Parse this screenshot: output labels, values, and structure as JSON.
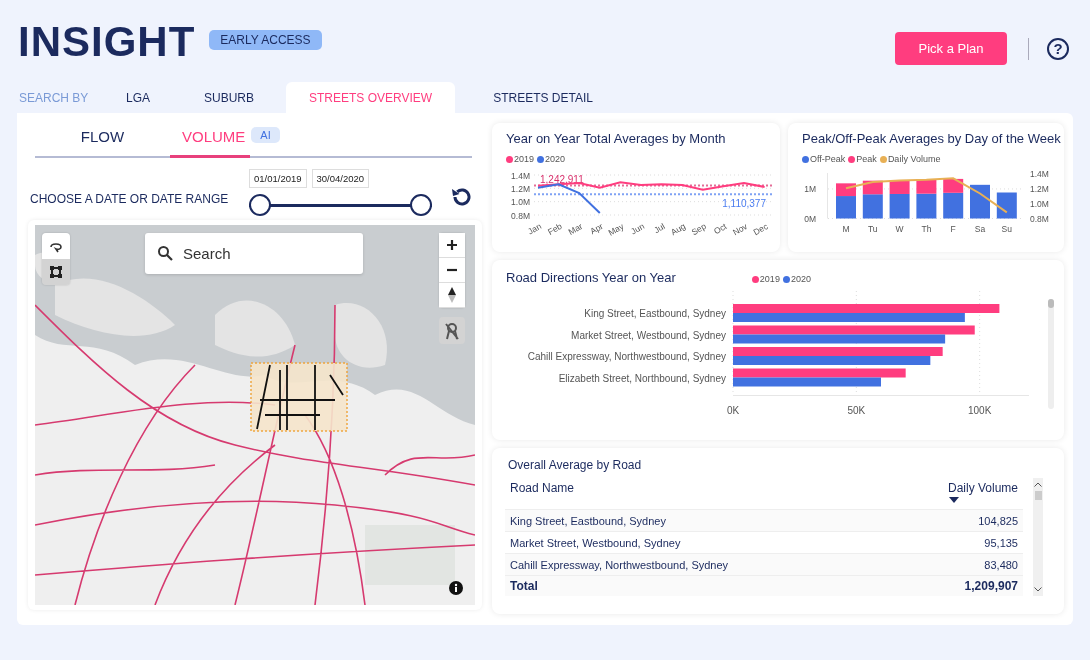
{
  "header": {
    "logo": "INSIGHT",
    "badge": "EARLY ACCESS",
    "plan_button": "Pick a Plan",
    "help_button": "?"
  },
  "nav": {
    "label": "SEARCH BY",
    "tabs": [
      {
        "label": "LGA",
        "selected": false
      },
      {
        "label": "SUBURB",
        "selected": false
      },
      {
        "label": "STREETS OVERVIEW",
        "selected": true
      },
      {
        "label": "STREETS DETAIL",
        "selected": false
      }
    ]
  },
  "view_tabs": [
    {
      "label": "FLOW",
      "selected": false
    },
    {
      "label": "VOLUME",
      "selected": true,
      "badge": "AI"
    }
  ],
  "date_range": {
    "label": "CHOOSE A DATE OR DATE RANGE",
    "start": "01/01/2019",
    "end": "30/04/2020",
    "slider": {
      "level": 1
    }
  },
  "map": {
    "kind": "picture",
    "search": {
      "placeholder": "Search"
    }
  },
  "charts": [
    {
      "chart_data": {
        "type": "line",
        "title": "Year on Year Total Averages by Month",
        "categories": [
          "Jan",
          "Feb",
          "Mar",
          "Apr",
          "May",
          "Jun",
          "Jul",
          "Aug",
          "Sep",
          "Oct",
          "Nov",
          "Dec"
        ],
        "ylim": [
          0.8,
          1.4
        ],
        "yticks": [
          {
            "value": 0.8,
            "label": "0.8M"
          },
          {
            "value": 1.0,
            "label": "1.0M"
          },
          {
            "value": 1.2,
            "label": "1.2M"
          },
          {
            "value": 1.4,
            "label": "1.4M"
          }
        ],
        "series": [
          {
            "name": "2019",
            "color": "#ff3d7f",
            "values": [
              1.24,
              1.26,
              1.28,
              1.21,
              1.29,
              1.25,
              1.26,
              1.25,
              1.18,
              1.23,
              1.28,
              1.22
            ]
          },
          {
            "name": "2020",
            "color": "#4171e0",
            "values": [
              1.21,
              1.26,
              1.13,
              0.83,
              null,
              null,
              null,
              null,
              null,
              null,
              null,
              null
            ]
          }
        ],
        "ref_lines": [
          {
            "axis": "y",
            "value": 1.242911,
            "label": "1,242,911",
            "color": "#d9306c"
          },
          {
            "axis": "y",
            "value": 1.110377,
            "label": "1,110,377",
            "color": "#4a7cf0"
          }
        ]
      }
    },
    {
      "chart_data": {
        "type": "bar",
        "stacked": true,
        "title": "Peak/Off-Peak Averages by Day of the Week",
        "categories": [
          "M",
          "Tu",
          "W",
          "Th",
          "F",
          "Sa",
          "Su"
        ],
        "ylim": [
          0,
          1.54
        ],
        "yticks": [
          {
            "value": 0,
            "label": "0M"
          },
          {
            "value": 1,
            "label": "1M"
          }
        ],
        "y2lim": [
          0.8,
          1.4
        ],
        "y2ticks": [
          {
            "value": 0.8,
            "label": "0.8M"
          },
          {
            "value": 1.0,
            "label": "1.0M"
          },
          {
            "value": 1.2,
            "label": "1.2M"
          },
          {
            "value": 1.4,
            "label": "1.4M"
          }
        ],
        "series": [
          {
            "name": "Off-Peak",
            "color": "#4171e0",
            "type": "bar",
            "values": [
              0.76,
              0.82,
              0.83,
              0.84,
              0.87,
              1.14,
              0.88
            ]
          },
          {
            "name": "Peak",
            "color": "#ff3d7f",
            "type": "bar",
            "values": [
              0.43,
              0.46,
              0.47,
              0.47,
              0.47,
              null,
              null
            ]
          },
          {
            "name": "Daily Volume",
            "color": "#e8b055",
            "type": "line",
            "axis": "y2",
            "values": [
              1.2,
              1.28,
              1.3,
              1.31,
              1.33,
              1.13,
              0.88
            ]
          }
        ]
      }
    },
    {
      "chart_data": {
        "type": "bar",
        "orientation": "horizontal",
        "title": "Road Directions Year on Year",
        "categories": [
          "King Street, Eastbound, Sydney",
          "Market Street, Westbound, Sydney",
          "Cahill Expressway, Northwestbound, Sydney",
          "Elizabeth Street, Northbound, Sydney"
        ],
        "xlim": [
          0,
          120000
        ],
        "xticks": [
          {
            "value": 0,
            "label": "0K"
          },
          {
            "value": 50000,
            "label": "50K"
          },
          {
            "value": 100000,
            "label": "100K"
          }
        ],
        "series": [
          {
            "name": "2019",
            "color": "#ff3d7f",
            "values": [
              108000,
              98000,
              85000,
              70000
            ]
          },
          {
            "name": "2020",
            "color": "#4171e0",
            "values": [
              94000,
              86000,
              80000,
              60000
            ]
          }
        ]
      }
    }
  ],
  "table": {
    "title": "Overall Average by Road",
    "columns": [
      {
        "label": "Road Name",
        "sorted": false
      },
      {
        "label": "Daily Volume",
        "sorted": true
      }
    ],
    "rows": [
      [
        "King Street, Eastbound, Sydney",
        "104,825"
      ],
      [
        "Market Street, Westbound, Sydney",
        "95,135"
      ],
      [
        "Cahill Expressway, Northwestbound, Sydney",
        "83,480"
      ]
    ],
    "total": [
      "Total",
      "1,209,907"
    ]
  }
}
